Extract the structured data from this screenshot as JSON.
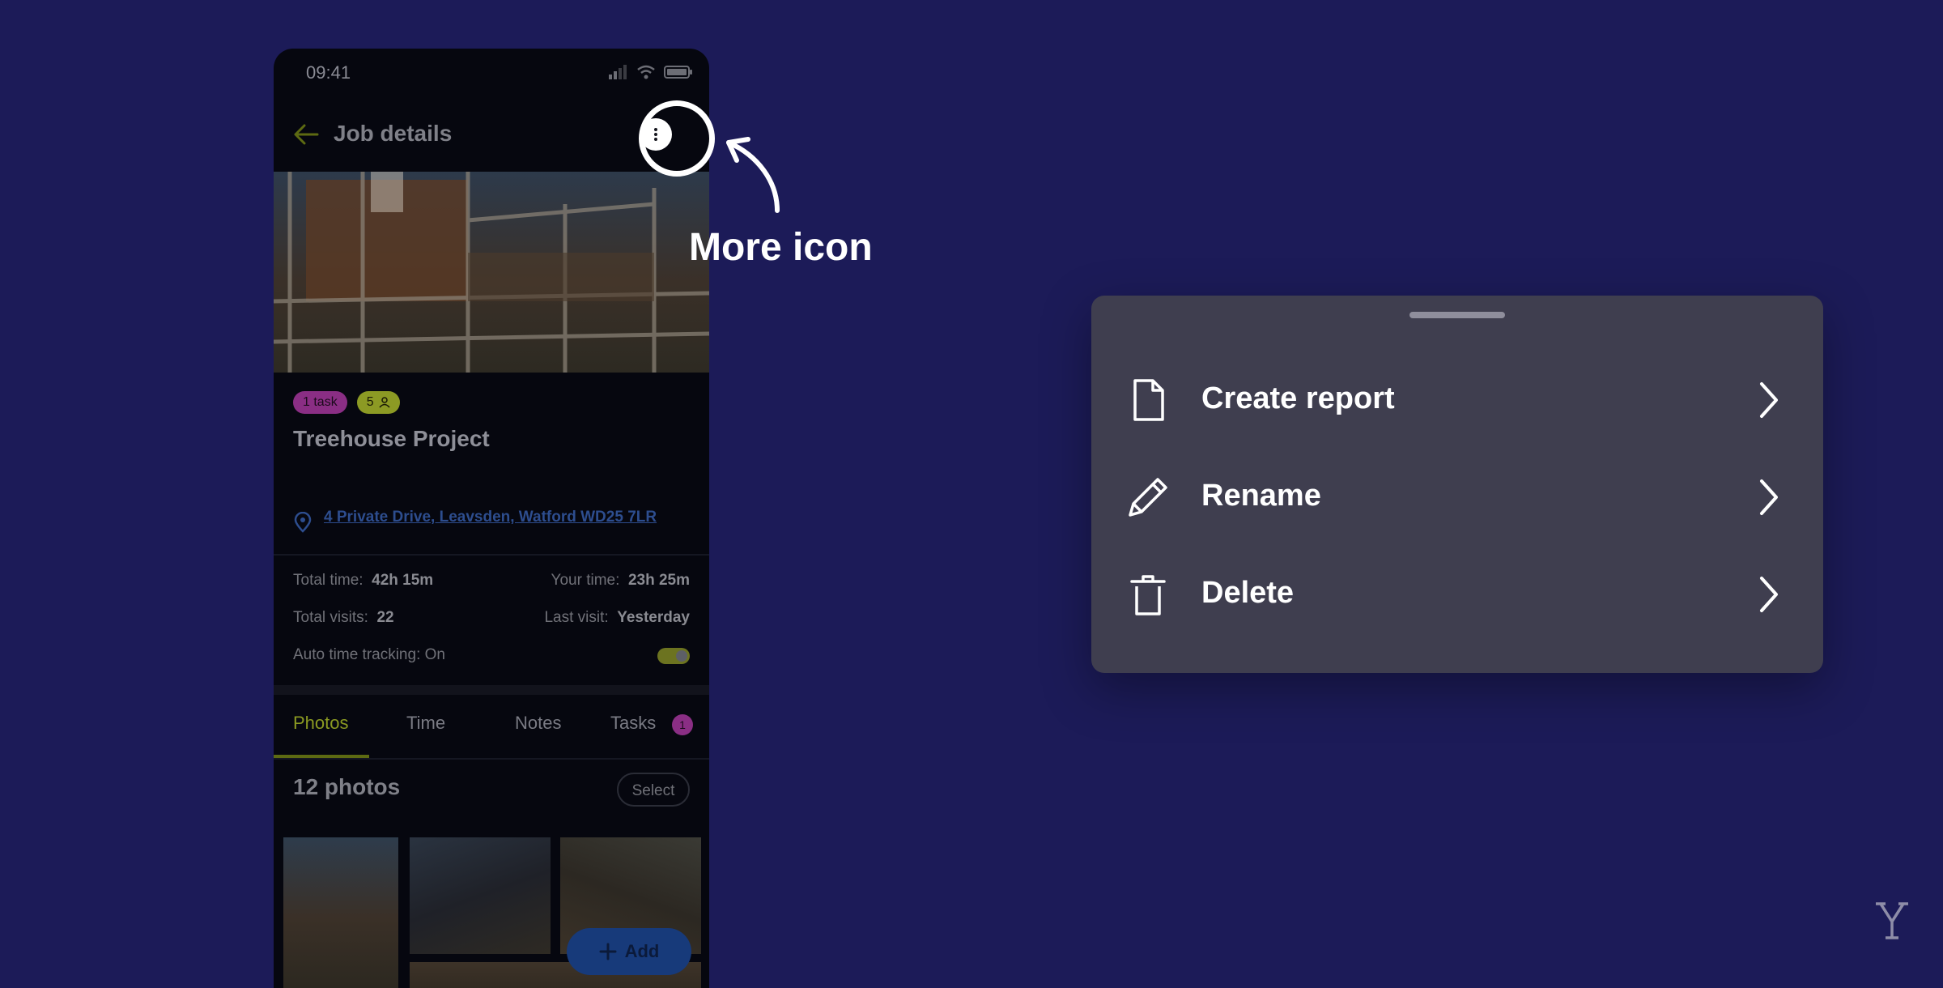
{
  "phone": {
    "status": {
      "time": "09:41"
    },
    "nav": {
      "title": "Job details"
    },
    "badges": {
      "task_label": "1 task",
      "people_count": "5"
    },
    "project": {
      "title": "Treehouse Project",
      "address": "4 Private Drive, Leavsden, Watford WD25 7LR"
    },
    "stats": {
      "total_time_label": "Total time:",
      "total_time_value": "42h 15m",
      "your_time_label": "Your time:",
      "your_time_value": "23h 25m",
      "total_visits_label": "Total visits:",
      "total_visits_value": "22",
      "last_visit_label": "Last visit:",
      "last_visit_value": "Yesterday",
      "auto_tracking_label": "Auto time tracking:",
      "auto_tracking_value": "On"
    },
    "tabs": [
      {
        "label": "Photos",
        "active": true
      },
      {
        "label": "Time"
      },
      {
        "label": "Notes"
      },
      {
        "label": "Tasks",
        "count": "1"
      }
    ],
    "photos": {
      "count_label": "12 photos",
      "select_label": "Select"
    },
    "add_button_label": "Add"
  },
  "annotation": {
    "label": "More icon"
  },
  "sheet": {
    "items": [
      {
        "label": "Create report",
        "icon": "document-icon"
      },
      {
        "label": "Rename",
        "icon": "pencil-icon"
      },
      {
        "label": "Delete",
        "icon": "trash-icon"
      }
    ]
  },
  "colors": {
    "background": "#1c1b58",
    "sheet": "#3f3e4f",
    "accent_green": "#8b9a22",
    "accent_purple": "#8a2e84",
    "link_blue": "#2d4d8e"
  }
}
